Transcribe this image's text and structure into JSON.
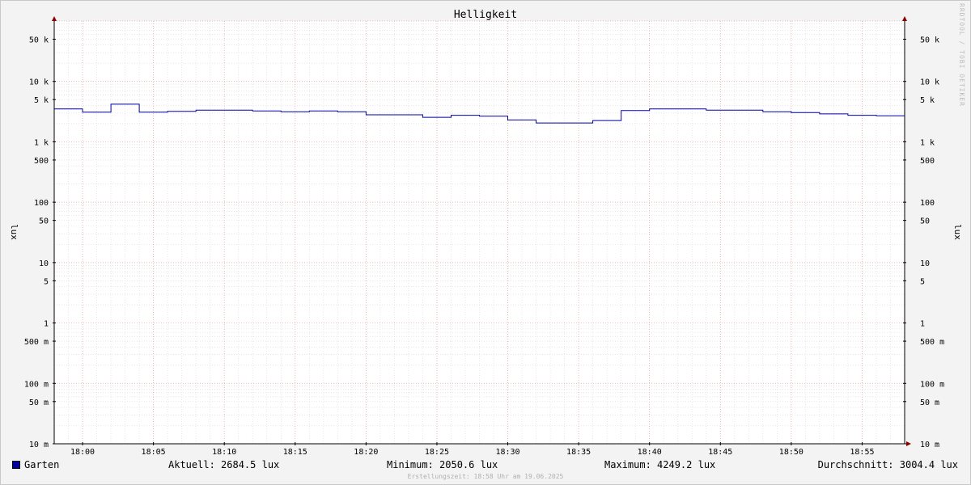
{
  "chart_data": {
    "type": "line",
    "title": "Helligkeit",
    "ylabel": "lux",
    "yscale": "log",
    "ylim": [
      0.01,
      100000
    ],
    "xlim": [
      "17:58",
      "17:58 +1h"
    ],
    "grid": true,
    "y_ticks": [
      {
        "value": 50000,
        "label": "50 k"
      },
      {
        "value": 10000,
        "label": "10 k"
      },
      {
        "value": 5000,
        "label": "5 k"
      },
      {
        "value": 1000,
        "label": "1 k"
      },
      {
        "value": 500,
        "label": "500"
      },
      {
        "value": 100,
        "label": "100"
      },
      {
        "value": 50,
        "label": "50"
      },
      {
        "value": 10,
        "label": "10"
      },
      {
        "value": 5,
        "label": "5"
      },
      {
        "value": 1,
        "label": "1"
      },
      {
        "value": 0.5,
        "label": "500 m"
      },
      {
        "value": 0.1,
        "label": "100 m"
      },
      {
        "value": 0.05,
        "label": "50 m"
      },
      {
        "value": 0.01,
        "label": "10 m"
      }
    ],
    "x_ticks": [
      "18:00",
      "18:05",
      "18:10",
      "18:15",
      "18:20",
      "18:25",
      "18:30",
      "18:35",
      "18:40",
      "18:45",
      "18:50",
      "18:55"
    ],
    "series": [
      {
        "name": "Garten",
        "color": "#0000a0",
        "x": [
          "17:58",
          "18:00",
          "18:02",
          "18:04",
          "18:06",
          "18:08",
          "18:10",
          "18:12",
          "18:14",
          "18:16",
          "18:18",
          "18:20",
          "18:22",
          "18:24",
          "18:26",
          "18:28",
          "18:30",
          "18:32",
          "18:34",
          "18:36",
          "18:38",
          "18:40",
          "18:42",
          "18:44",
          "18:46",
          "18:48",
          "18:50",
          "18:52",
          "18:54",
          "18:56"
        ],
        "values": [
          3500,
          3100,
          4200,
          3100,
          3200,
          3350,
          3350,
          3250,
          3150,
          3250,
          3150,
          2800,
          2800,
          2550,
          2750,
          2650,
          2300,
          2050,
          2050,
          2250,
          3300,
          3500,
          3500,
          3350,
          3350,
          3150,
          3050,
          2900,
          2750,
          2700
        ]
      }
    ]
  },
  "legend": {
    "series_name": "Garten",
    "current": "Aktuell: 2684.5 lux",
    "minimum": "Minimum: 2050.6 lux",
    "maximum": "Maximum: 4249.2 lux",
    "average": "Durchschnitt: 3004.4 lux"
  },
  "watermark": "RRDTOOL / TOBI OETIKER",
  "footer": "Erstellungszeit: 18:58 Uhr am 19.06.2025"
}
